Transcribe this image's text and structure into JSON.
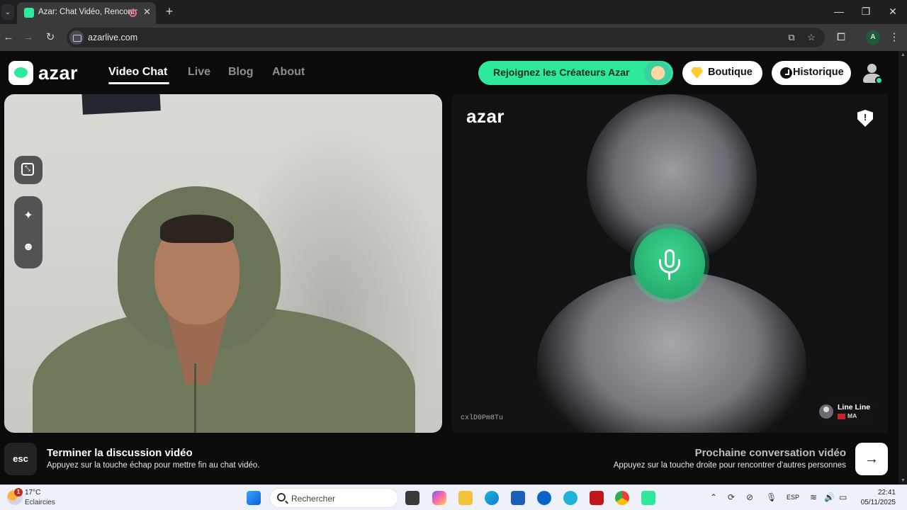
{
  "browser": {
    "tab_title": "Azar: Chat Vidéo, Rencontre",
    "tab_close": "✕",
    "new_tab": "+",
    "url": "azarlive.com",
    "profile_initial": "A",
    "window_controls": {
      "minimize": "—",
      "maximize": "❐",
      "close": "✕"
    }
  },
  "site": {
    "logo_text": "azar",
    "nav": [
      {
        "label": "Video Chat",
        "active": true
      },
      {
        "label": "Live"
      },
      {
        "label": "Blog"
      },
      {
        "label": "About"
      }
    ],
    "creators_cta": "Rejoignez les Créateurs Azar",
    "shop_label": "Boutique",
    "history_label": "Historique",
    "colors": {
      "accent": "#2ee89c",
      "background": "#0b0b0c"
    }
  },
  "call": {
    "watermark": "azar",
    "peer_id": "cxlD0Pm8Tu",
    "peer_name": "Line Line",
    "peer_country": "MA",
    "report_symbol": "!",
    "mic_state": "active"
  },
  "controls": {
    "esc_key": "esc",
    "end_title": "Terminer la discussion vidéo",
    "end_subtitle": "Appuyez sur la touche échap pour mettre fin au chat vidéo.",
    "next_title": "Prochaine conversation vidéo",
    "next_subtitle": "Appuyez sur la touche droite pour rencontrer d'autres personnes",
    "next_arrow": "→"
  },
  "taskbar": {
    "weather_badge": "1",
    "temperature": "17°C",
    "condition": "Eclaircies",
    "search_placeholder": "Rechercher",
    "language": "ESP",
    "time": "22:41",
    "date": "05/11/2025"
  }
}
